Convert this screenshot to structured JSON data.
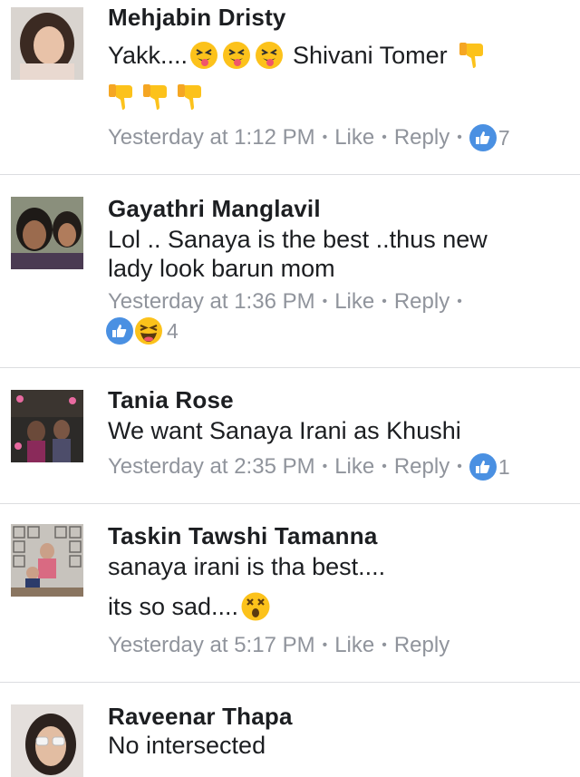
{
  "comments": [
    {
      "author": "Mehjabin Dristy",
      "text_1": "Yakk....",
      "mention": "Shivani Tomer",
      "icons": [
        "squinting-tongue-emoji",
        "thumbs-down-emoji"
      ],
      "time": "Yesterday at 1:12 PM",
      "like_label": "Like",
      "reply_label": "Reply",
      "reaction_count": "7"
    },
    {
      "author": "Gayathri Manglavil",
      "text_1": "Lol .. Sanaya is the best ..thus new",
      "text_2": "lady look barun mom",
      "time": "Yesterday at 1:36 PM",
      "like_label": "Like",
      "reply_label": "Reply",
      "icons": [
        "like-reaction-icon",
        "haha-reaction-icon"
      ],
      "reaction_count": "4"
    },
    {
      "author": "Tania Rose",
      "text_1": "We want Sanaya Irani as Khushi",
      "time": "Yesterday at 2:35 PM",
      "like_label": "Like",
      "reply_label": "Reply",
      "reaction_count": "1"
    },
    {
      "author": "Taskin Tawshi Tamanna",
      "text_1": "sanaya irani is tha best....",
      "text_2": "its so sad....",
      "icons": [
        "astonished-face-emoji"
      ],
      "time": "Yesterday at 5:17 PM",
      "like_label": "Like",
      "reply_label": "Reply"
    },
    {
      "author": "Raveenar Thapa",
      "text_1": "No intersected"
    }
  ],
  "colors": {
    "name": "#1c1e21",
    "meta": "#90949c",
    "like_badge": "#4a90e2",
    "divider": "#dcdde0",
    "emoji_yellow": "#fcc21b"
  }
}
